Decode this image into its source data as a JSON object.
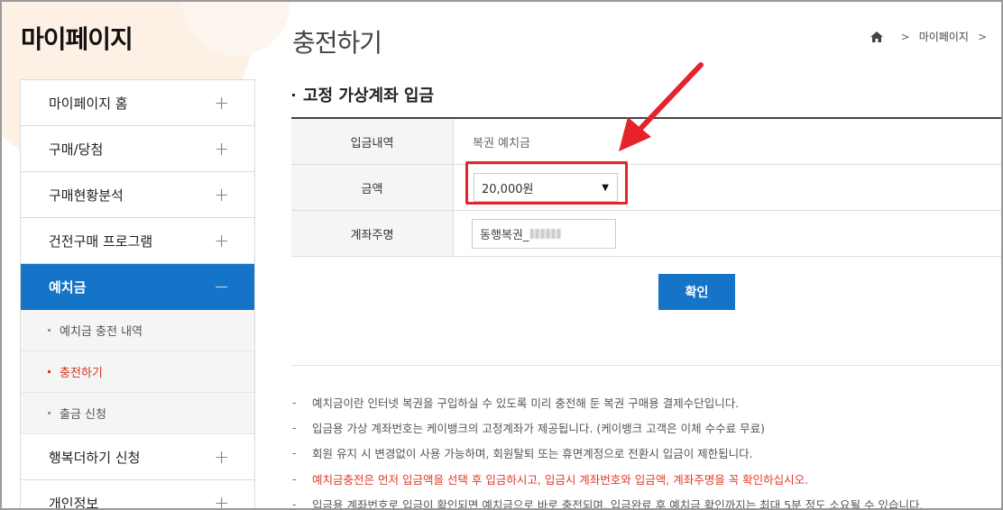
{
  "sidebar": {
    "title": "마이페이지",
    "items": [
      {
        "label": "마이페이지 홈",
        "icon": "+"
      },
      {
        "label": "구매/당첨",
        "icon": "+"
      },
      {
        "label": "구매현황분석",
        "icon": "+"
      },
      {
        "label": "건전구매 프로그램",
        "icon": "+"
      }
    ],
    "active": {
      "label": "예치금",
      "icon": "−"
    },
    "sub_items": [
      {
        "label": "예치금 충전 내역"
      },
      {
        "label": "충전하기"
      },
      {
        "label": "출금 신청"
      }
    ],
    "items_after": [
      {
        "label": "행복더하기 신청",
        "icon": "+"
      },
      {
        "label": "개인정보",
        "icon": "+"
      }
    ]
  },
  "header": {
    "page_title": "충전하기",
    "breadcrumb": {
      "separator": ">",
      "current": "마이페이지",
      "trailing": ">"
    }
  },
  "section": {
    "title": "고정 가상계좌 입금"
  },
  "form": {
    "rows": {
      "deposit_type": {
        "label": "입금내역",
        "value": "복권 예치금"
      },
      "amount": {
        "label": "금액",
        "selected": "20,000원",
        "arrow": "▼"
      },
      "account_name": {
        "label": "계좌주명",
        "value": "동행복권_"
      }
    },
    "confirm_label": "확인"
  },
  "notes": {
    "dash": "-",
    "lines": [
      "예치금이란 인터넷 복권을 구입하실 수 있도록 미리 충전해 둔 복권 구매용 결제수단입니다.",
      "입금용 가상 계좌번호는 케이뱅크의 고정계좌가 제공됩니다. (케이뱅크 고객은 이체 수수료 무료)",
      "회원 유지 시 변경없이 사용 가능하며, 회원탈퇴 또는 휴면계정으로 전환시 입금이 제한됩니다.",
      "예치금충전은 먼저 입금액을 선택 후 입금하시고, 입금시 계좌번호와 입금액, 계좌주명을 꼭 확인하십시오.",
      "입금용 계좌번호로 입금이 확인되면 예치금으로 바로 충전되며, 입금완료 후 예치금 확인까지는 최대 5분 정도 소요될 수 있습니다."
    ]
  },
  "colors": {
    "accent_blue": "#1674c8",
    "annotation_red": "#e5232a",
    "warning_red": "#e03a2a"
  }
}
